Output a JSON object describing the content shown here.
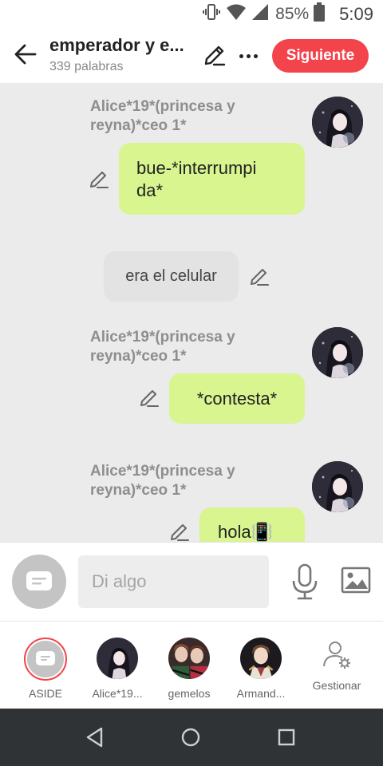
{
  "status_bar": {
    "battery_percent": "85%",
    "time": "5:09"
  },
  "header": {
    "title": "emperador y e...",
    "word_count": "339 palabras",
    "next_label": "Siguiente"
  },
  "messages": [
    {
      "type": "character",
      "sender": "Alice*19*(princesa y reyna)*ceo 1*",
      "text": "bue-*interrumpi\nda*"
    },
    {
      "type": "narration",
      "text": "era el celular"
    },
    {
      "type": "character",
      "sender": "Alice*19*(princesa y reyna)*ceo 1*",
      "text": "*contesta*"
    },
    {
      "type": "character",
      "sender": "Alice*19*(princesa y reyna)*ceo 1*",
      "text": "hola📳"
    }
  ],
  "input": {
    "placeholder": "Di algo"
  },
  "characters": [
    {
      "name": "ASIDE",
      "icon": "aside-icon"
    },
    {
      "name": "Alice*19...",
      "icon": "avatar"
    },
    {
      "name": "gemelos",
      "icon": "avatar"
    },
    {
      "name": "Armand...",
      "icon": "avatar"
    },
    {
      "name": "Gestionar",
      "icon": "manage-users-icon"
    }
  ],
  "colors": {
    "accent": "#f3434b",
    "bubble_character": "#d8f58f",
    "bubble_narration": "#e3e3e3",
    "chat_background": "#ebebeb",
    "nav_bar": "#2f3336"
  }
}
